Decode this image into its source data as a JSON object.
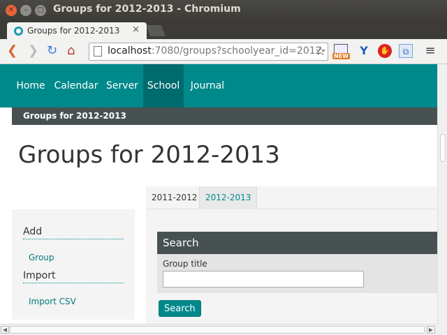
{
  "window": {
    "title": "Groups for 2012-2013 - Chromium"
  },
  "browser": {
    "tab_title": "Groups for 2012-2013",
    "tab_close": "×",
    "url_host": "localhost",
    "url_rest": ":7080/groups?schoolyear_id=2012-",
    "ext_new_badge": "NEW"
  },
  "nav": {
    "items": [
      {
        "label": "Home"
      },
      {
        "label": "Calendar"
      },
      {
        "label": "Server"
      },
      {
        "label": "School",
        "active": true
      },
      {
        "label": "Journal"
      }
    ]
  },
  "breadcrumb": "Groups for 2012-2013",
  "page_title": "Groups for 2012-2013",
  "tabs": [
    {
      "label": "2011-2012"
    },
    {
      "label": "2012-2013",
      "active": true
    }
  ],
  "sidebar": {
    "sections": [
      {
        "heading": "Add",
        "link": "Group"
      },
      {
        "heading": "Import",
        "link": "Import CSV"
      }
    ]
  },
  "search": {
    "heading": "Search",
    "field_label": "Group title",
    "field_value": "",
    "button_label": "Search"
  },
  "colors": {
    "accent": "#00898b",
    "dark_bar": "#485151"
  }
}
